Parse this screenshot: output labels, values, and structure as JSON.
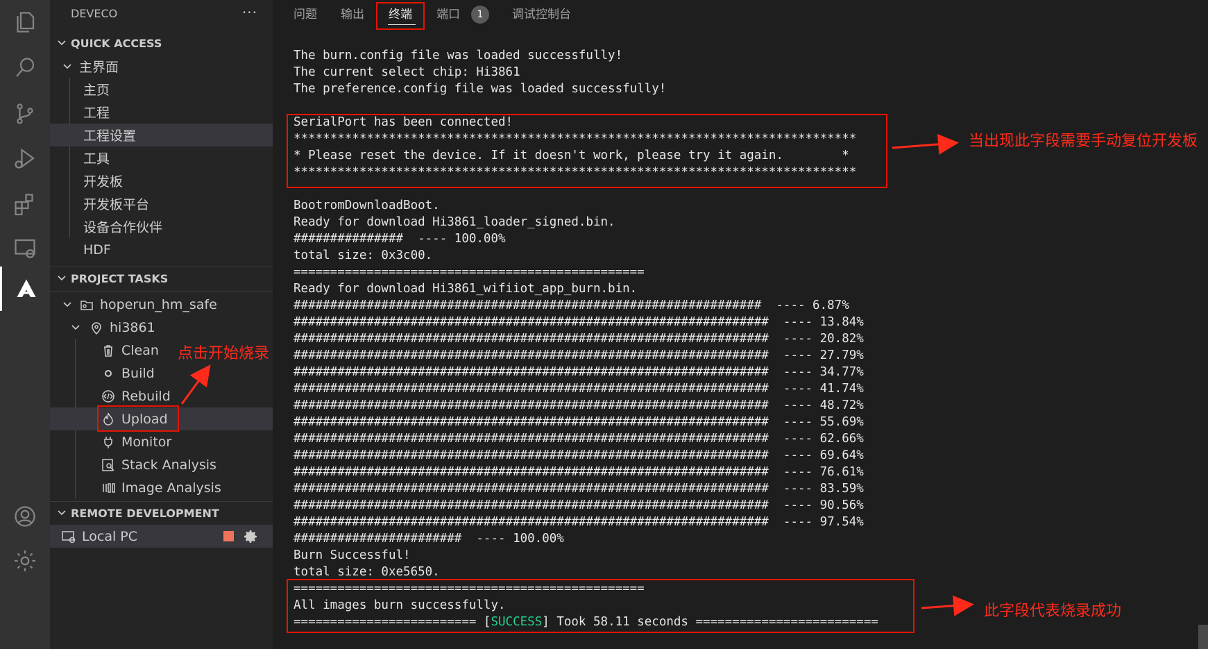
{
  "activity_bar": {
    "icons": [
      "files-icon",
      "search-icon",
      "source-control-icon",
      "run-debug-icon",
      "extensions-icon",
      "remote-explorer-icon",
      "deveco-icon",
      "account-icon",
      "settings-gear-icon"
    ]
  },
  "sidebar": {
    "title": "DEVECO",
    "more": "···",
    "quick_access": {
      "header": "QUICK ACCESS",
      "group": "主界面",
      "items": [
        "主页",
        "工程",
        "工程设置",
        "工具",
        "开发板",
        "开发板平台",
        "设备合作伙伴",
        "HDF"
      ]
    },
    "project_tasks": {
      "header": "PROJECT TASKS",
      "project": "hoperun_hm_safe",
      "target": "hi3861",
      "tasks": [
        "Clean",
        "Build",
        "Rebuild",
        "Upload",
        "Monitor",
        "Stack Analysis",
        "Image Analysis"
      ]
    },
    "remote": {
      "header": "REMOTE DEVELOPMENT",
      "item": "Local PC"
    }
  },
  "panel": {
    "tabs": [
      "问题",
      "输出",
      "终端",
      "端口",
      "调试控制台"
    ],
    "active_tab": "终端",
    "ports_badge": "1",
    "terminal_lines": [
      "The burn.config file was loaded successfully!",
      "The current select chip: Hi3861",
      "The preference.config file was loaded successfully!",
      "",
      "SerialPort has been connected!",
      "*****************************************************************************",
      "* Please reset the device. If it doesn't work, please try it again.        *",
      "*****************************************************************************",
      "",
      "BootromDownloadBoot.",
      "Ready for download Hi3861_loader_signed.bin.",
      "###############  ---- 100.00%",
      "total size: 0x3c00.",
      "================================================",
      "Ready for download Hi3861_wifiiot_app_burn.bin.",
      "################################################################  ---- 6.87%",
      "#################################################################  ---- 13.84%",
      "#################################################################  ---- 20.82%",
      "#################################################################  ---- 27.79%",
      "#################################################################  ---- 34.77%",
      "#################################################################  ---- 41.74%",
      "#################################################################  ---- 48.72%",
      "#################################################################  ---- 55.69%",
      "#################################################################  ---- 62.66%",
      "#################################################################  ---- 69.64%",
      "#################################################################  ---- 76.61%",
      "#################################################################  ---- 83.59%",
      "#################################################################  ---- 90.56%",
      "#################################################################  ---- 97.54%",
      "#######################  ---- 100.00%",
      "Burn Successful!",
      "total size: 0xe5650.",
      "================================================",
      "All images burn successfully."
    ],
    "final_line": {
      "prefix": "========================= [",
      "status": "SUCCESS",
      "suffix": "] Took 58.11 seconds ========================="
    }
  },
  "annotations": {
    "reset_note": "当出现此字段需要手动复位开发板",
    "upload_note": "点击开始烧录",
    "success_note": "此字段代表烧录成功"
  },
  "colors": {
    "annotation_red": "#e51400",
    "success_green": "#23d18b"
  }
}
